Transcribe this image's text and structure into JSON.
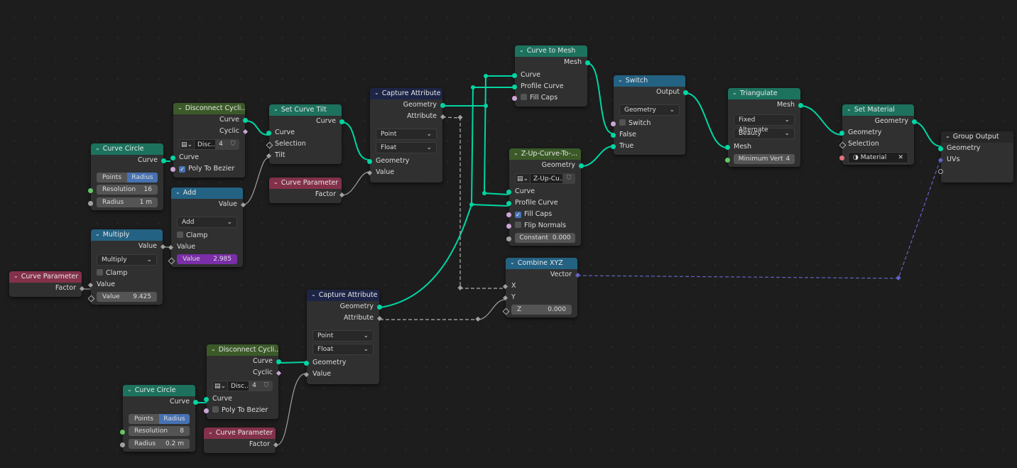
{
  "editor": "Geometry Node Editor",
  "nodes": {
    "curve_circle_1": {
      "title": "Curve Circle",
      "out_curve": "Curve",
      "mode_points": "Points",
      "mode_radius": "Radius",
      "mode_selected": "Radius",
      "resolution_label": "Resolution",
      "resolution": "16",
      "radius_label": "Radius",
      "radius": "1 m"
    },
    "disconnect_1": {
      "title": "Disconnect Cycli...",
      "out_curve": "Curve",
      "out_cyclic": "Cyclic",
      "group_name": "Disc...",
      "users": "4",
      "in_curve": "Curve",
      "poly_label": "Poly To Bezier",
      "poly_checked": true
    },
    "add": {
      "title": "Add",
      "out_value": "Value",
      "operation": "Add",
      "clamp": "Clamp",
      "in_value": "Value",
      "value_label": "Value",
      "value": "2.985"
    },
    "multiply": {
      "title": "Multiply",
      "out_value": "Value",
      "operation": "Multiply",
      "clamp": "Clamp",
      "in_value": "Value",
      "value_label": "Value",
      "value": "9.425"
    },
    "curve_param_1": {
      "title": "Curve Parameter",
      "out_factor": "Factor"
    },
    "set_tilt": {
      "title": "Set Curve Tilt",
      "out_curve": "Curve",
      "in_curve": "Curve",
      "in_selection": "Selection",
      "in_tilt": "Tilt"
    },
    "curve_param_2": {
      "title": "Curve Parameter",
      "out_factor": "Factor"
    },
    "capture_1": {
      "title": "Capture Attribute",
      "out_geometry": "Geometry",
      "out_attribute": "Attribute",
      "domain": "Point",
      "type": "Float",
      "in_geometry": "Geometry",
      "in_value": "Value"
    },
    "curve_to_mesh": {
      "title": "Curve to Mesh",
      "out_mesh": "Mesh",
      "in_curve": "Curve",
      "in_profile": "Profile Curve",
      "fill_caps": "Fill Caps"
    },
    "zup": {
      "title": "Z-Up-Curve-To-...",
      "out_geometry": "Geometry",
      "group_name": "Z-Up-Cu...",
      "in_curve": "Curve",
      "in_profile": "Profile Curve",
      "fill_caps": "Fill Caps",
      "flip_normals": "Flip Normals",
      "constant_label": "Constant",
      "constant": "0.000"
    },
    "switch": {
      "title": "Switch",
      "out_output": "Output",
      "type": "Geometry",
      "switch_label": "Switch",
      "in_false": "False",
      "in_true": "True"
    },
    "triangulate": {
      "title": "Triangulate",
      "out_mesh": "Mesh",
      "quad": "Fixed Alternate",
      "ngon": "Beauty",
      "in_mesh": "Mesh",
      "minvert_label": "Minimum Vert",
      "minvert": "4"
    },
    "set_material": {
      "title": "Set Material",
      "out_geometry": "Geometry",
      "in_geometry": "Geometry",
      "in_selection": "Selection",
      "material": "Material"
    },
    "group_output": {
      "title": "Group Output",
      "in_geometry": "Geometry",
      "in_uvs": "UVs"
    },
    "combine_xyz": {
      "title": "Combine XYZ",
      "out_vector": "Vector",
      "in_x": "X",
      "in_y": "Y",
      "z_label": "Z",
      "z": "0.000"
    },
    "capture_2": {
      "title": "Capture Attribute",
      "out_geometry": "Geometry",
      "out_attribute": "Attribute",
      "domain": "Point",
      "type": "Float",
      "in_geometry": "Geometry",
      "in_value": "Value"
    },
    "disconnect_2": {
      "title": "Disconnect Cycli...",
      "out_curve": "Curve",
      "out_cyclic": "Cyclic",
      "group_name": "Disc...",
      "users": "4",
      "in_curve": "Curve",
      "poly_label": "Poly To Bezier",
      "poly_checked": false
    },
    "curve_circle_2": {
      "title": "Curve Circle",
      "out_curve": "Curve",
      "mode_points": "Points",
      "mode_radius": "Radius",
      "mode_selected": "Radius",
      "resolution_label": "Resolution",
      "resolution": "8",
      "radius_label": "Radius",
      "radius": "0.2 m"
    },
    "curve_param_3": {
      "title": "Curve Parameter",
      "out_factor": "Factor"
    }
  },
  "colors": {
    "geometry_socket": "#00d6a3",
    "float_socket": "#a1a1a1",
    "bool_socket": "#cca6d6",
    "vector_socket": "#6363c7",
    "int_socket": "#63c763",
    "material_socket": "#e1747e"
  }
}
